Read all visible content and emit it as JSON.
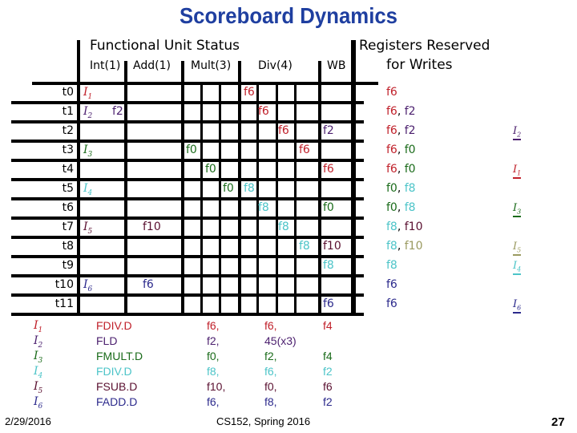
{
  "title": "Scoreboard Dynamics",
  "header": {
    "fu_status": "Functional Unit Status",
    "reg_reserved_line1": "Registers Reserved",
    "reg_reserved_line2": "for Writes",
    "units": [
      "Int(1)",
      "Add(1)",
      "Mult(3)",
      "Div(4)",
      "WB"
    ]
  },
  "colors": {
    "I1": "#c0202a",
    "I2": "#4b1f6e",
    "I3": "#1a6b1a",
    "I4": "#4cc4c8",
    "I5": "#5a1030",
    "I5b": "#9a9a60",
    "I6": "#2c2a8c",
    "header": "#1f3fa0"
  },
  "times": [
    "t0",
    "t1",
    "t2",
    "t3",
    "t4",
    "t5",
    "t6",
    "t7",
    "t8",
    "t9",
    "t10",
    "t11"
  ],
  "grid": [
    {
      "row": 0,
      "col": "int",
      "text": "I1",
      "sub": "1",
      "kind": "instr",
      "color": "I1"
    },
    {
      "row": 0,
      "col": "div1",
      "text": "f6",
      "color": "I1"
    },
    {
      "row": 1,
      "col": "int",
      "text": "I2",
      "sub": "2",
      "kind": "instr",
      "color": "I2"
    },
    {
      "row": 1,
      "col": "int2",
      "text": "f2",
      "color": "I2"
    },
    {
      "row": 1,
      "col": "div2",
      "text": "f6",
      "color": "I1"
    },
    {
      "row": 2,
      "col": "div3",
      "text": "f6",
      "color": "I1"
    },
    {
      "row": 2,
      "col": "wb",
      "text": "f2",
      "color": "I2"
    },
    {
      "row": 3,
      "col": "int",
      "text": "I3",
      "sub": "3",
      "kind": "instr",
      "color": "I3"
    },
    {
      "row": 3,
      "col": "mult1",
      "text": "f0",
      "color": "I3"
    },
    {
      "row": 3,
      "col": "div4",
      "text": "f6",
      "color": "I1"
    },
    {
      "row": 4,
      "col": "mult2",
      "text": "f0",
      "color": "I3"
    },
    {
      "row": 4,
      "col": "wb",
      "text": "f6",
      "color": "I1"
    },
    {
      "row": 5,
      "col": "int",
      "text": "I4",
      "sub": "4",
      "kind": "instr",
      "color": "I4"
    },
    {
      "row": 5,
      "col": "mult3",
      "text": "f0",
      "color": "I3"
    },
    {
      "row": 5,
      "col": "div1",
      "text": "f8",
      "color": "I4"
    },
    {
      "row": 6,
      "col": "div2",
      "text": "f8",
      "color": "I4"
    },
    {
      "row": 6,
      "col": "wb",
      "text": "f0",
      "color": "I3"
    },
    {
      "row": 7,
      "col": "int",
      "text": "I5",
      "sub": "5",
      "kind": "instr",
      "color": "I5"
    },
    {
      "row": 7,
      "col": "add",
      "text": "f10",
      "color": "I5"
    },
    {
      "row": 7,
      "col": "div3",
      "text": "f8",
      "color": "I4"
    },
    {
      "row": 8,
      "col": "div4",
      "text": "f8",
      "color": "I4"
    },
    {
      "row": 8,
      "col": "wb",
      "text": "f10",
      "color": "I5"
    },
    {
      "row": 9,
      "col": "wb",
      "text": "f8",
      "color": "I4"
    },
    {
      "row": 10,
      "col": "int",
      "text": "I6",
      "sub": "6",
      "kind": "instr",
      "color": "I6"
    },
    {
      "row": 10,
      "col": "add",
      "text": "f6",
      "color": "I6"
    },
    {
      "row": 11,
      "col": "wb",
      "text": "f6",
      "color": "I6"
    }
  ],
  "registers": [
    [
      {
        "t": "f6",
        "c": "I1"
      }
    ],
    [
      {
        "t": "f6",
        "c": "I1"
      },
      {
        "t": "f2",
        "c": "I2"
      }
    ],
    [
      {
        "t": "f6",
        "c": "I1"
      },
      {
        "t": "f2",
        "c": "I2"
      }
    ],
    [
      {
        "t": "f6",
        "c": "I1"
      },
      {
        "t": "f0",
        "c": "I3"
      }
    ],
    [
      {
        "t": "f6",
        "c": "I1"
      },
      {
        "t": "f0",
        "c": "I3"
      }
    ],
    [
      {
        "t": "f0",
        "c": "I3"
      },
      {
        "t": "f8",
        "c": "I4"
      }
    ],
    [
      {
        "t": "f0",
        "c": "I3"
      },
      {
        "t": "f8",
        "c": "I4"
      }
    ],
    [
      {
        "t": "f8",
        "c": "I4"
      },
      {
        "t": "f10",
        "c": "I5"
      }
    ],
    [
      {
        "t": "f8",
        "c": "I4"
      },
      {
        "t": "f10",
        "c": "I5b"
      }
    ],
    [
      {
        "t": "f8",
        "c": "I4"
      }
    ],
    [
      {
        "t": "f6",
        "c": "I6"
      }
    ],
    [
      {
        "t": "f6",
        "c": "I6"
      }
    ]
  ],
  "annotations": [
    {
      "row": 2,
      "text": "I",
      "sub": "2",
      "c": "I2"
    },
    {
      "row": 4,
      "text": "I",
      "sub": "1",
      "c": "I1"
    },
    {
      "row": 6,
      "text": "I",
      "sub": "3",
      "c": "I3"
    },
    {
      "row": 8,
      "text": "I",
      "sub": "5",
      "c": "I5b"
    },
    {
      "row": 9,
      "text": "I",
      "sub": "4",
      "c": "I4"
    },
    {
      "row": 11,
      "text": "I",
      "sub": "6",
      "c": "I6"
    }
  ],
  "instructions": [
    {
      "id": "I",
      "sub": "1",
      "op": "FDIV.D",
      "a": "f6,",
      "b": "f6,",
      "c": "f4",
      "color": "I1"
    },
    {
      "id": "I",
      "sub": "2",
      "op": "FLD",
      "a": "f2,",
      "b": "45(x3)",
      "c": "",
      "color": "I2"
    },
    {
      "id": "I",
      "sub": "3",
      "op": "FMULT.D",
      "a": "f0,",
      "b": "f2,",
      "c": "f4",
      "color": "I3"
    },
    {
      "id": "I",
      "sub": "4",
      "op": "FDIV.D",
      "a": "f8,",
      "b": "f6,",
      "c": "f2",
      "color": "I4"
    },
    {
      "id": "I",
      "sub": "5",
      "op": "FSUB.D",
      "a": "f10,",
      "b": "f0,",
      "c": "f6",
      "color": "I5"
    },
    {
      "id": "I",
      "sub": "6",
      "op": "FADD.D",
      "a": "f6,",
      "b": "f8,",
      "c": "f2",
      "color": "I6"
    }
  ],
  "footer": {
    "date": "2/29/2016",
    "course": "CS152, Spring 2016",
    "page": "27"
  }
}
